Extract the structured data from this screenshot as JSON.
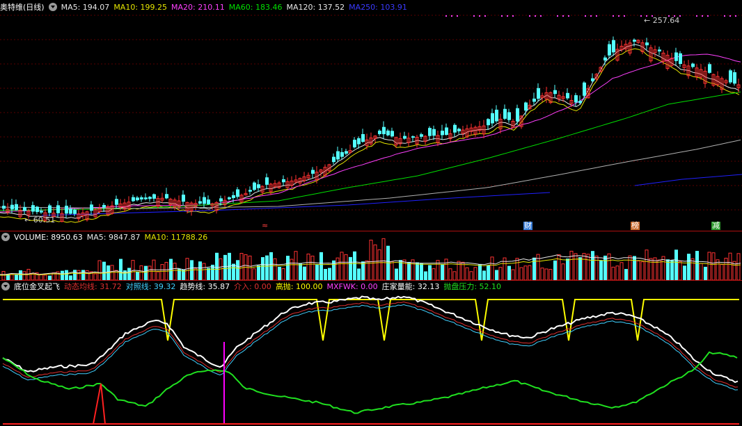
{
  "price_panel": {
    "legend": {
      "stock_name": "奥特维(日线)",
      "ma5": "MA5: 194.07",
      "ma10": "MA10: 199.25",
      "ma20": "MA20: 210.11",
      "ma60": "MA60: 183.46",
      "ma120": "MA120: 137.52",
      "ma250": "MA250: 103.91"
    },
    "high_label": "257.64",
    "low_label": "60.51",
    "markers": [
      {
        "text": "≈",
        "color": "#ff4040"
      },
      {
        "text": "财",
        "color": "#66aaff"
      },
      {
        "text": "榜",
        "color": "#ff8844"
      },
      {
        "text": "减",
        "color": "#66dd66"
      }
    ]
  },
  "volume_panel": {
    "legend": {
      "volume": "VOLUME: 8950.63",
      "ma5": "MA5: 9847.87",
      "ma10": "MA10: 11788.26"
    }
  },
  "indicator_panel": {
    "legend": {
      "name": "底位金叉起飞",
      "dynamic": "动态均线: 31.72",
      "reference": "对照线: 39.32",
      "trend": "趋势线: 35.87",
      "entry": "介入: 0.00",
      "high_sell": "高抛: 100.00",
      "mxfwk": "MXFWK: 0.00",
      "banker": "庄家量能: 32.13",
      "pressure": "抛盘压力: 52.10"
    }
  },
  "colors": {
    "background": "#000000",
    "separator": "#b01010",
    "up_candle": "#ff3232",
    "down_candle": "#54ffff",
    "ma5": "#e8e8e8",
    "ma10": "#e6e600",
    "ma20": "#ff40ff",
    "ma60": "#00e000",
    "ma120": "#b0b0b0",
    "ma250": "#2020ff",
    "dynamic": "#e03030",
    "reference": "#40d0ff",
    "trend": "#ffffff",
    "high_sell": "#ffff00",
    "pressure": "#20e020",
    "mxfwk": "#ff00ff"
  }
}
